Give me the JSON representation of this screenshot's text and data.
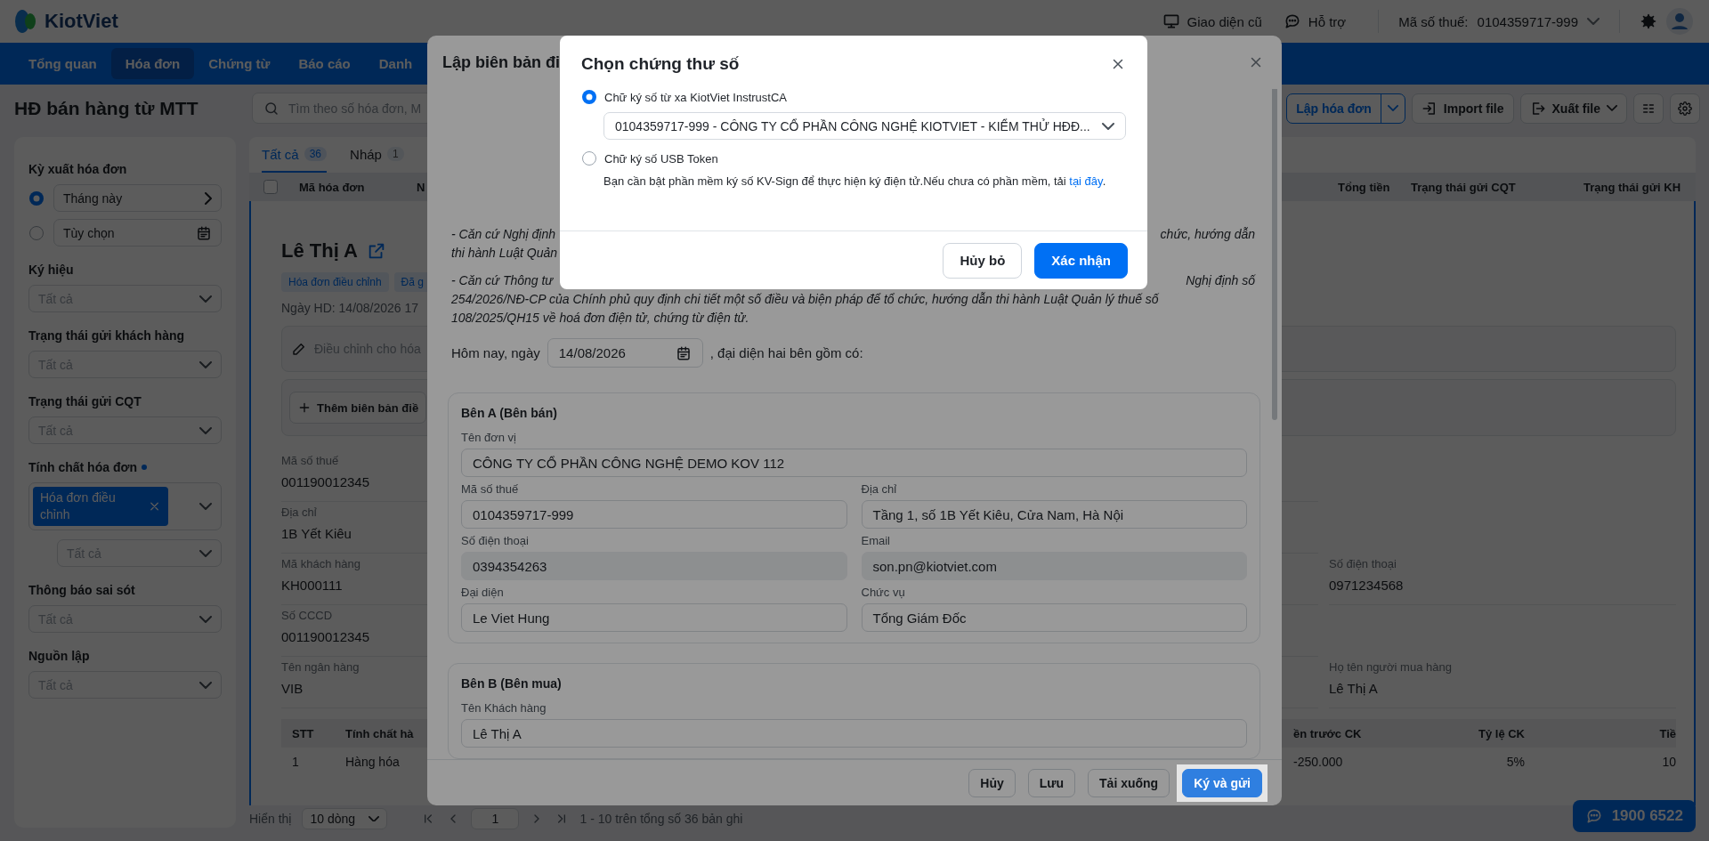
{
  "topbar": {
    "logo": "KiotViet",
    "links": [
      {
        "label": "Giao diện cũ",
        "kind": "monitor"
      },
      {
        "label": "Hỗ trợ",
        "kind": "chat"
      }
    ],
    "tax_label": "Mã số thuế:",
    "tax_value": "0104359717-999"
  },
  "nav": [
    {
      "label": "Tổng quan",
      "selected": false
    },
    {
      "label": "Hóa đơn",
      "selected": true
    },
    {
      "label": "Chứng từ",
      "selected": false
    },
    {
      "label": "Báo cáo",
      "selected": false
    },
    {
      "label": "Danh",
      "selected": false
    }
  ],
  "page": {
    "title": "HĐ bán hàng từ MTT",
    "search_placeholder": "Tìm theo số hóa đơn, M",
    "actions": [
      {
        "label": "Lập hóa đơn",
        "kind": "split"
      },
      {
        "label": "Import file",
        "kind": "import"
      },
      {
        "label": "Xuất file",
        "kind": "export"
      }
    ]
  },
  "sidebar": {
    "sections": [
      {
        "kind": "period",
        "title": "Kỳ xuất hóa đơn",
        "options": [
          {
            "label": "Tháng này",
            "selected": true
          },
          {
            "label": "Tùy chọn",
            "selected": false
          }
        ]
      },
      {
        "kind": "select",
        "title": "Ký hiệu",
        "value": "Tất cả"
      },
      {
        "kind": "select",
        "title": "Trạng thái gửi khách hàng",
        "value": "Tất cả"
      },
      {
        "kind": "select",
        "title": "Trạng thái gửi CQT",
        "value": "Tất cả"
      },
      {
        "kind": "multi",
        "title": "Tính chất hóa đơn",
        "active": true,
        "chips": [
          "Hóa đơn điều chỉnh"
        ],
        "sub_value": "Tất cả"
      },
      {
        "kind": "select",
        "title": "Thông báo sai sót",
        "value": "Tất cả"
      },
      {
        "kind": "select",
        "title": "Nguồn lập",
        "value": "Tất cả"
      }
    ]
  },
  "tabs": [
    {
      "label": "Tất cả",
      "count": "36",
      "selected": true
    },
    {
      "label": "Nháp",
      "count": "1",
      "selected": false
    }
  ],
  "table": {
    "select_all": {
      "checked": false
    },
    "columns_left": [
      "Mã hóa đơn",
      "N"
    ],
    "columns_right": [
      "Tổng tiền",
      "Trạng thái gửi CQT",
      "Trạng thái gửi KH"
    ]
  },
  "detail": {
    "name": "Lê Thị A",
    "tags": [
      "Hóa đơn điều chỉnh",
      "Đã g"
    ],
    "date": "Ngày HD: 14/08/2026 17",
    "adjust": "Điều chỉnh cho hóa",
    "add_record": "Thêm biên bản điề",
    "field_rows": [
      [
        {
          "label": "Mã số thuế",
          "value": "001190012345"
        }
      ],
      [
        {
          "label": "Địa chỉ",
          "value": "1B Yết Kiêu"
        }
      ],
      [
        {
          "label": "Mã khách hàng",
          "value": "KH000111"
        },
        {
          "label": "Số điện thoại",
          "value": "0971234568"
        }
      ],
      [
        {
          "label": "Số CCCD",
          "value": "001190012345"
        }
      ],
      [
        {
          "label": "Tên ngân hàng",
          "value": "VIB"
        },
        {
          "label": "Họ tên người mua hàng",
          "value": "Lê Thị A"
        }
      ]
    ],
    "items": {
      "columns": [
        "STT",
        "Tính chất hà",
        "ền trước CK",
        "Tỷ lệ CK",
        "Tiề"
      ],
      "rows": [
        [
          "1",
          "Hàng hóa",
          "-250.000",
          "5%",
          "10"
        ]
      ]
    }
  },
  "pagination": {
    "label": "Hiển thị",
    "page_size": "10 dòng",
    "page": "1",
    "summary": "1 - 10 trên tổng số 36 bản ghi"
  },
  "hotline": "1900 6522",
  "modal": {
    "title": "Lập biên bản đi",
    "paragraphs": [
      [
        {
          "left": "- Căn cứ Nghị định",
          "right": "chức, hướng dẫn"
        },
        {
          "left": "thi hành Luật Quản"
        }
      ],
      [
        {
          "left": "- Căn cứ Thông tư",
          "right": "Nghị định số"
        },
        {
          "left": "254/2026/NĐ-CP của Chính phủ quy định chi tiết một số điều và biện pháp để tổ chức, hướng dẫn thi hành Luật Quản lý thuế số"
        },
        {
          "left": "108/2025/QH15 về hoá đơn điện tử, chứng từ điện tử."
        }
      ]
    ],
    "date_label": "Hôm nay, ngày",
    "date": "14/08/2026",
    "date_suffix": ", đại diện hai bên gồm có:",
    "parties": [
      {
        "title": "Bên A (Bên bán)",
        "fields": [
          {
            "label": "Tên đơn vị",
            "value": "CÔNG TY CỔ PHẦN CÔNG NGHỆ DEMO KOV 112",
            "wide": true,
            "disabled": false
          },
          {
            "label": "Mã số thuế",
            "value": "0104359717-999",
            "wide": false,
            "disabled": false
          },
          {
            "label": "Địa chỉ",
            "value": "Tầng 1, số 1B Yết Kiêu, Cửa Nam, Hà Nội",
            "wide": false,
            "disabled": false
          },
          {
            "label": "Số điện thoại",
            "value": "0394354263",
            "wide": false,
            "disabled": true
          },
          {
            "label": "Email",
            "value": "son.pn@kiotviet.com",
            "wide": false,
            "disabled": true
          },
          {
            "label": "Đại diện",
            "value": "Le Viet Hung",
            "wide": false,
            "disabled": false
          },
          {
            "label": "Chức vụ",
            "value": "Tổng Giám Đốc",
            "wide": false,
            "disabled": false
          }
        ]
      },
      {
        "title": "Bên B (Bên mua)",
        "fields": [
          {
            "label": "Tên Khách hàng",
            "value": "Lê Thị A",
            "wide": true,
            "disabled": false
          }
        ]
      }
    ],
    "buttons": [
      {
        "label": "Hủy",
        "kind": "secondary",
        "highlighted": false
      },
      {
        "label": "Lưu",
        "kind": "secondary",
        "highlighted": false
      },
      {
        "label": "Tải xuống",
        "kind": "secondary",
        "highlighted": false
      },
      {
        "label": "Ký và gửi",
        "kind": "primary",
        "highlighted": true
      }
    ]
  },
  "dialog": {
    "title": "Chọn chứng thư số",
    "options": [
      {
        "label": "Chữ ký số từ xa KiotViet InstrustCA",
        "selected": true
      },
      {
        "label": "Chữ ký số USB Token",
        "selected": false
      }
    ],
    "certificate": "0104359717-999 - CÔNG TY CỔ PHẦN CÔNG NGHỆ KIOTVIET - KIỂM THỬ HĐĐ...",
    "note": "Bạn cần bật phần mềm ký số KV-Sign để thực hiện ký điện tử.Nếu chưa có phần mềm, tải ",
    "note_link": "tại đây",
    "note_end": ".",
    "buttons": [
      {
        "label": "Hủy bỏ",
        "kind": "secondary"
      },
      {
        "label": "Xác nhận",
        "kind": "primary"
      }
    ]
  }
}
